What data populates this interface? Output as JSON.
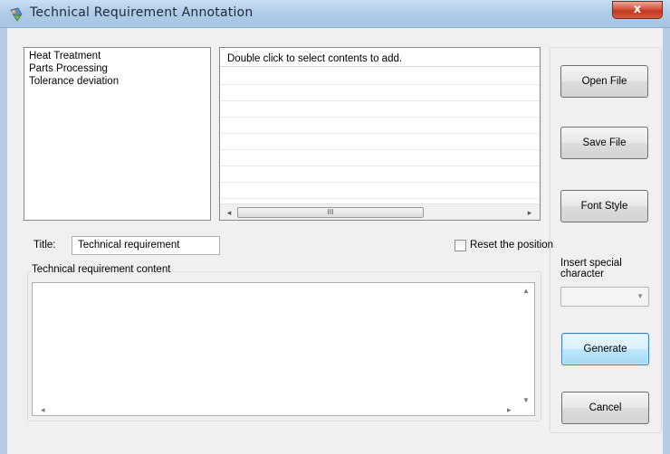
{
  "window": {
    "title": "Technical Requirement Annotation",
    "close_glyph": "x"
  },
  "categories": [
    "Heat Treatment",
    "Parts Processing",
    "Tolerance deviation"
  ],
  "content_grid": {
    "header": "Double click to select contents to add.",
    "scroll_thumb_glyph": "III"
  },
  "buttons": {
    "open_file": "Open File",
    "save_file": "Save File",
    "font_style": "Font Style",
    "generate": "Generate",
    "cancel": "Cancel"
  },
  "title_field": {
    "label": "Title:",
    "value": "Technical requirement"
  },
  "reset_position": {
    "label": "Reset the position",
    "checked": false
  },
  "special_character": {
    "label": "Insert special character",
    "selected": ""
  },
  "content_group": {
    "caption": "Technical requirement content",
    "value": ""
  },
  "colors": {
    "titlebar": "#b1cce8",
    "close_button": "#d6533c",
    "focused_button": "#bee6fd"
  }
}
